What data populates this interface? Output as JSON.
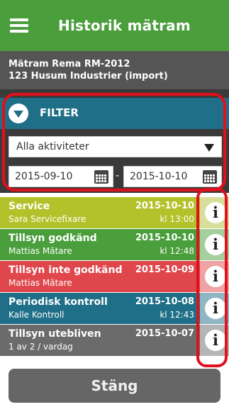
{
  "header": {
    "title": "Historik mätram",
    "menu_icon": "hamburger-menu-icon"
  },
  "device": {
    "name": "Mätram Rema RM-2012",
    "owner": "123 Husum Industrier (import)"
  },
  "filter": {
    "label": "FILTER",
    "toggle_icon": "chevron-down-icon",
    "activity_selected": "Alla aktiviteter",
    "date_from": "2015-09-10",
    "date_separator": "-",
    "date_to": "2015-10-10",
    "calendar_icon": "calendar-icon"
  },
  "activities": [
    {
      "title": "Service",
      "person": "Sara Servicefixare",
      "date": "2015-10-10",
      "time": "kl 13:00",
      "color": "#b3c22a",
      "info_color": "#d8df9a"
    },
    {
      "title": "Tillsyn godkänd",
      "person": "Mattias Mätare",
      "date": "2015-10-10",
      "time": "kl 12:48",
      "color": "#4a9e3c",
      "info_color": "#a5cf9d"
    },
    {
      "title": "Tillsyn inte godkänd",
      "person": "Mattias Mätare",
      "date": "2015-10-09",
      "time": "",
      "color": "#e0474c",
      "info_color": "#f0a3a5"
    },
    {
      "title": "Periodisk kontroll",
      "person": "Kalle Kontroll",
      "date": "2015-10-08",
      "time": "kl 12:43",
      "color": "#1e6f87",
      "info_color": "#8fb7c3"
    },
    {
      "title": "Tillsyn utebliven",
      "person": "1 av 2 / vardag",
      "date": "2015-10-07",
      "time": "",
      "color": "#6b6b6b",
      "info_color": "#b5b5b5"
    }
  ],
  "info_icon_glyph": "i",
  "close_label": "Stäng"
}
